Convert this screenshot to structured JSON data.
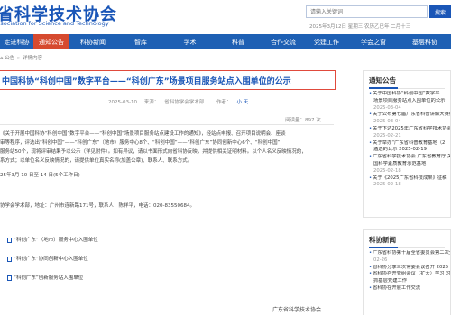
{
  "header": {
    "logo_cn": "省科学技术协会",
    "logo_en": "ssociation for Science and Technology",
    "search_placeholder": "请输入关键词",
    "search_button": "搜索",
    "date_line": "2025年3月12日 星期三 农历乙巳年 二月十三"
  },
  "nav": {
    "items": [
      {
        "label": "走进科协",
        "active": false,
        "width": 37
      },
      {
        "label": "通知公告",
        "active": true,
        "width": 40
      },
      {
        "label": "科协新闻",
        "active": false,
        "width": 52
      },
      {
        "label": "智库",
        "active": false,
        "width": 54
      },
      {
        "label": "学术",
        "active": false,
        "width": 55
      },
      {
        "label": "科普",
        "active": false,
        "width": 52
      },
      {
        "label": "合作交流",
        "active": false,
        "width": 48
      },
      {
        "label": "党建工作",
        "active": false,
        "width": 48
      },
      {
        "label": "学会之窗",
        "active": false,
        "width": 56
      },
      {
        "label": "基层科协",
        "active": false,
        "width": 58
      }
    ]
  },
  "breadcrumb": {
    "parts": [
      "公告",
      "详情内容"
    ]
  },
  "article": {
    "title": "中国科协“科创中国”数字平台——“科创广东”场景项目服务站点入围单位的公示",
    "date": "2025-03-10",
    "source_label": "来源：",
    "source": "省科协学会学术部",
    "author_label": "作者：",
    "author": "小 天",
    "views": "阅读量：897 次",
    "paragraphs": [
      "《关于开展中国科协“科创中国”数字平台——“科创中国”场景项目服务站点建设工作的通知》，经站点申报、召开项目说明会、座谈",
      "审等程序，评选出“科创中国”——“科创广东”（地市）服务中心8个、“科创中国”——“科创广东”协同创新中心6个、“科创中国”",
      "服务站50个，现将评审结果予以公示（详见附件）。如有异议，请以书面形式向省科协反映，并提供相关证明材料。以个人名义反映情况的，",
      "系方式；以单位名义反映情况的，请提供单位真实名称(加盖公章)、联系人、联系方式。"
    ],
    "period": "25年3月 10 日至 14 日(5个工作日)",
    "contact": "协学会学术部，地址：广州市连新路171号，联系人：陈祥平，电话：020-83550684。",
    "attachments": [
      "“科创广东”（地市）服务中心入围单位",
      "“科创广东”协同创新中心入围单位",
      "“科创广东”创新服务站入围单位"
    ],
    "signature": "广东省科学技术协会"
  },
  "sidebar": {
    "notice_title": "通知公告",
    "notices": [
      {
        "text": "关于中国科协“科创中国”数字平",
        "type": "item"
      },
      {
        "text": "场景项目服务站点入围单位的公示",
        "type": "cont"
      },
      {
        "text": "2025-03-04",
        "type": "date"
      },
      {
        "text": "关于公布第七届广东省科普讲解大赛结",
        "type": "item"
      },
      {
        "text": "2025-03-04",
        "type": "date"
      },
      {
        "text": "关于下达2025年广东省科学技术协会",
        "type": "item"
      },
      {
        "text": "2025-02-21",
        "type": "date"
      },
      {
        "text": "关于举办“广东省科普教育基地（2",
        "type": "item"
      },
      {
        "text": "遴选的公示 2025-02-19",
        "type": "cont"
      },
      {
        "text": "广东省科学技术协会 广东省教育厅 关",
        "type": "item"
      },
      {
        "text": "国科学素质教育示范基地",
        "type": "cont"
      },
      {
        "text": "2025-02-18",
        "type": "date"
      },
      {
        "text": "关于《2025广东省科技成果》征稿",
        "type": "item"
      },
      {
        "text": "2025-02-18",
        "type": "date"
      }
    ],
    "news_title": "科协新闻",
    "news": [
      {
        "text": "广东省科协第十届全省委员会第二次全",
        "type": "item"
      },
      {
        "text": "02-26",
        "type": "date"
      },
      {
        "text": "省科协分享三次常委会议召开 2025",
        "type": "item"
      },
      {
        "text": "省科协召开党组会议（扩大）学习 习近",
        "type": "item"
      },
      {
        "text": "抓基层党建工作",
        "type": "cont"
      },
      {
        "text": "省科协在开展工作交流",
        "type": "item"
      }
    ]
  }
}
